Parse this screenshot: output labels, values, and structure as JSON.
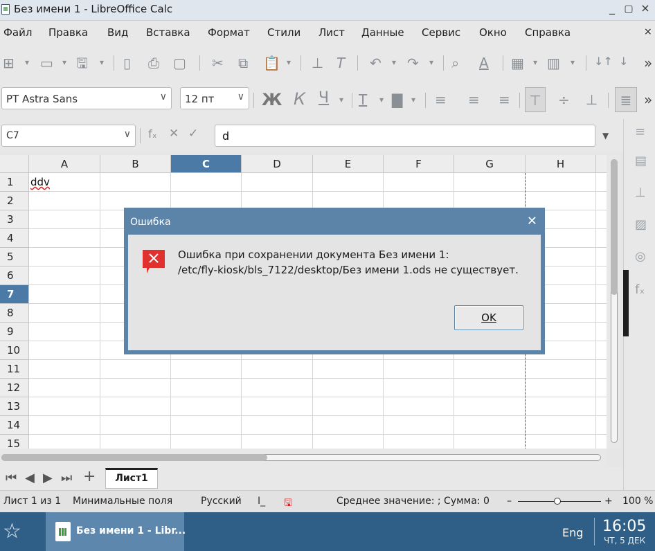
{
  "window": {
    "title": "Без имени 1 - LibreOffice Calc",
    "minimize": "_",
    "restore": "▢",
    "close": "×"
  },
  "menu": {
    "items": [
      "Файл",
      "Правка",
      "Вид",
      "Вставка",
      "Формат",
      "Стили",
      "Лист",
      "Данные",
      "Сервис",
      "Окно",
      "Справка"
    ],
    "doc_close": "×"
  },
  "format": {
    "font_name": "PT Astra Sans",
    "font_size": "12 пт",
    "bold": "Ж",
    "italic": "К",
    "underline": "Ч"
  },
  "formula_bar": {
    "cell_ref": "C7",
    "fx": "fₓ",
    "cancel": "✕",
    "accept": "✓",
    "content": "d"
  },
  "grid": {
    "columns": [
      "A",
      "B",
      "C",
      "D",
      "E",
      "F",
      "G",
      "H"
    ],
    "selected_column": "C",
    "rows": [
      "1",
      "2",
      "3",
      "4",
      "5",
      "6",
      "7",
      "8",
      "9",
      "10",
      "11",
      "12",
      "13",
      "14",
      "15"
    ],
    "selected_row": "7",
    "cells": {
      "A1": "ddv"
    }
  },
  "sheets": {
    "tabs": [
      "Лист1"
    ],
    "add": "+"
  },
  "status": {
    "sheet_of": "Лист 1 из 1",
    "page_style": "Минимальные поля",
    "language": "Русский",
    "summary": "Среднее значение: ; Сумма: 0",
    "zoom_minus": "–",
    "zoom_plus": "+",
    "zoom": "100 %"
  },
  "taskbar": {
    "app_label": "Без имени 1 - Libr...",
    "lang": "Eng",
    "time": "16:05",
    "date": "ЧТ, 5 ДЕК"
  },
  "dialog": {
    "title": "Ошибка",
    "message_line1": "Ошибка при сохранении документа Без имени 1:",
    "message_line2": "/etc/fly-kiosk/bls_7122/desktop/Без имени 1.ods не существует.",
    "ok_label": "OK"
  },
  "colors": {
    "accent": "#5b84a8",
    "selected_header": "#4b7aa6",
    "taskbar": "#2f5f86",
    "error_icon": "#e0312f"
  }
}
